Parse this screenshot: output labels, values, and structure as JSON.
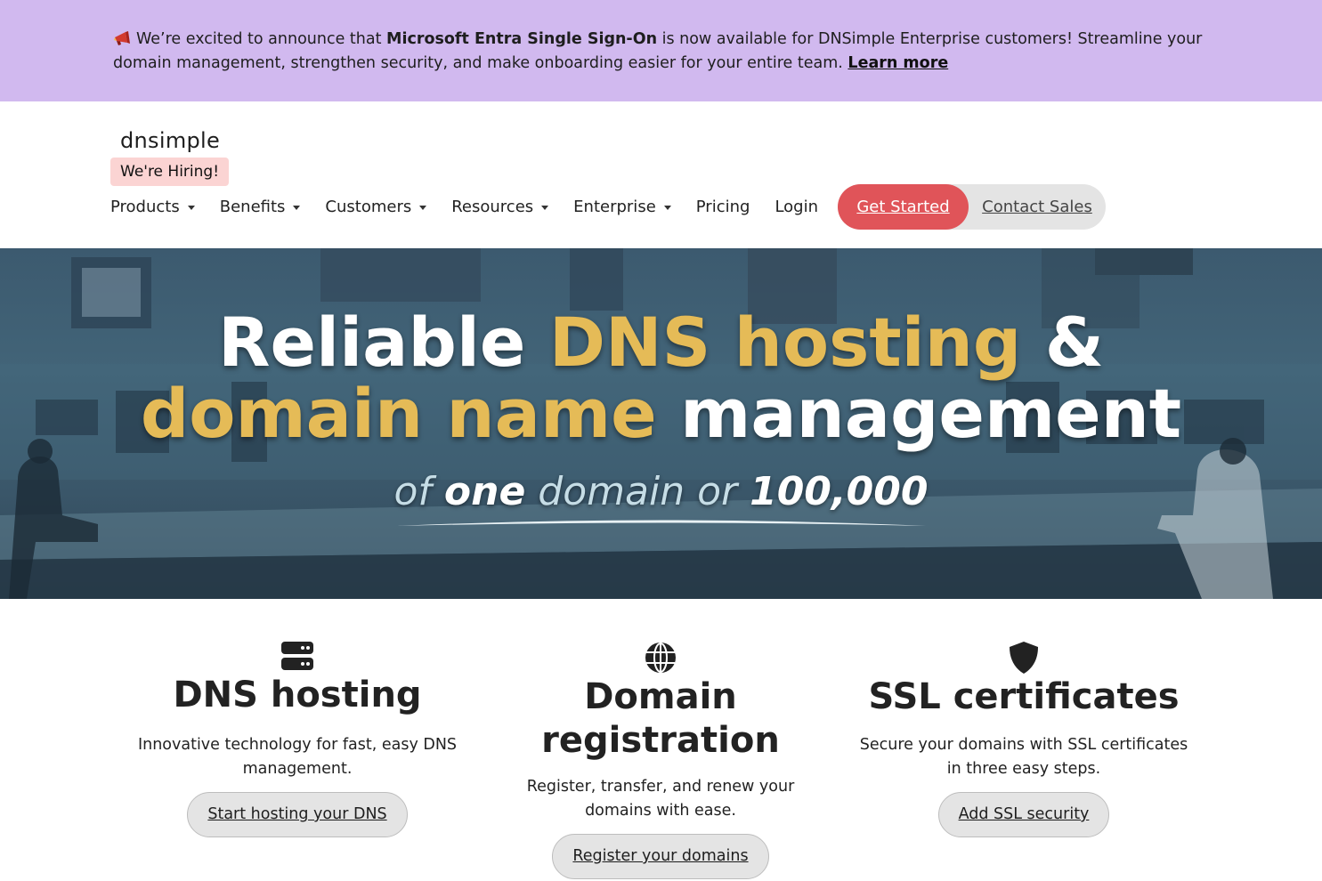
{
  "announcement": {
    "prefix": "We’re excited to announce that ",
    "highlight": "Microsoft Entra Single Sign-On",
    "suffix": " is now available for DNSimple Enterprise customers! Streamline your domain management, strengthen security, and make onboarding easier for your entire team. ",
    "link_label": "Learn more",
    "icon": "megaphone-icon"
  },
  "header": {
    "logo": "dnsimple",
    "hiring_label": "We're Hiring!",
    "nav": [
      {
        "label": "Products",
        "dropdown": true
      },
      {
        "label": "Benefits",
        "dropdown": true
      },
      {
        "label": "Customers",
        "dropdown": true
      },
      {
        "label": "Resources",
        "dropdown": true
      },
      {
        "label": "Enterprise",
        "dropdown": true
      },
      {
        "label": "Pricing",
        "dropdown": false
      },
      {
        "label": "Login",
        "dropdown": false
      }
    ],
    "get_started_label": "Get Started",
    "contact_sales_label": "Contact Sales"
  },
  "hero": {
    "line1_white": "Reliable ",
    "line1_gold": "DNS hosting",
    "line1_white_end": " &",
    "line2_gold": "domain name",
    "line2_white": " management",
    "sub_of": "of ",
    "sub_one": "one",
    "sub_mid": " domain or ",
    "sub_num": "100,000"
  },
  "features": [
    {
      "icon": "server-icon",
      "title": "DNS hosting",
      "text": "Innovative technology for fast, easy DNS management.",
      "button": "Start hosting your DNS"
    },
    {
      "icon": "globe-icon",
      "title": "Domain registration",
      "text": "Register, transfer, and renew your domains with ease.",
      "button": "Register your domains"
    },
    {
      "icon": "shield-icon",
      "title": "SSL certificates",
      "text": "Secure your domains with SSL certificates in three easy steps.",
      "button": "Add SSL security"
    }
  ],
  "colors": {
    "banner_bg": "#d1b9ef",
    "accent_red": "#e05459",
    "hero_gold": "#e5bb57",
    "hiring_bg": "#fbd4d3",
    "pill_bg": "#e4e4e4"
  }
}
